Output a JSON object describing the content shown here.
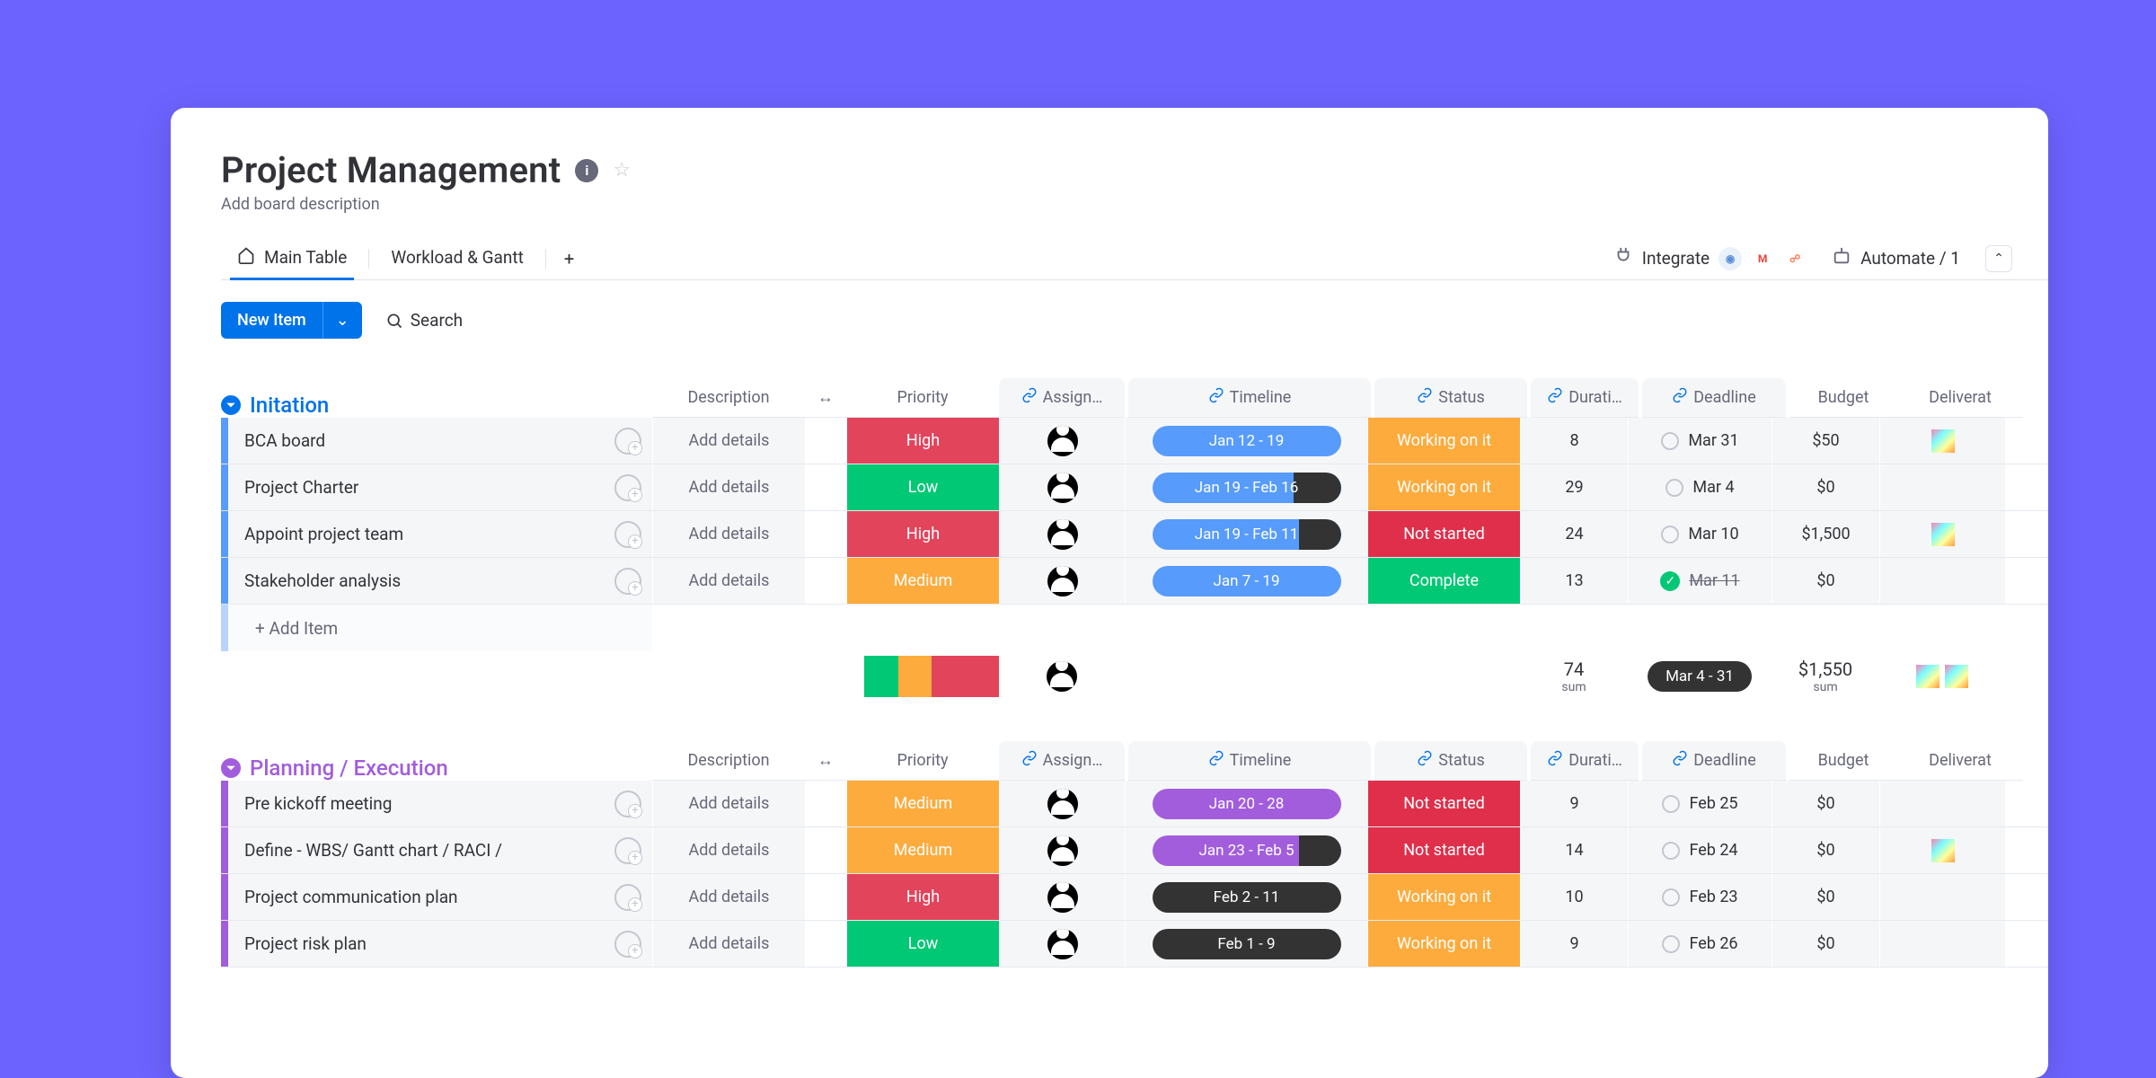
{
  "title": "Project Management",
  "description_placeholder": "Add board description",
  "tabs": {
    "main": "Main Table",
    "workload": "Workload & Gantt"
  },
  "toolbar": {
    "integrate_label": "Integrate",
    "automate_label": "Automate / 1",
    "new_item_label": "New Item",
    "search_label": "Search"
  },
  "columns": {
    "description": "Description",
    "drag": "↔",
    "priority": "Priority",
    "assignee": "Assign…",
    "timeline": "Timeline",
    "status": "Status",
    "duration": "Durati…",
    "deadline": "Deadline",
    "budget": "Budget",
    "deliverable": "Deliverat"
  },
  "priority_colors": {
    "High": "#e2445c",
    "Low": "#00c875",
    "Medium": "#fdab3d"
  },
  "status_colors": {
    "Working on it": "#fdab3d",
    "Not started": "#df2f4a",
    "Complete": "#00c875"
  },
  "group_ui": {
    "add_details": "Add details",
    "add_item": "+ Add Item",
    "sum_label": "sum"
  },
  "groups": [
    {
      "name": "Initation",
      "color": "#579BFC",
      "title_color": "#0073ea",
      "rows": [
        {
          "name": "BCA board",
          "priority": "High",
          "timeline": "Jan 12 - 19",
          "tl_color": "#579BFC",
          "tl_dark_pct": 0,
          "status": "Working on it",
          "duration": "8",
          "deadline": "Mar 31",
          "deadline_done": false,
          "budget": "$50",
          "deliverable": true
        },
        {
          "name": "Project Charter",
          "priority": "Low",
          "timeline": "Jan 19 - Feb 16",
          "tl_color": "#579BFC",
          "tl_dark_pct": 25,
          "status": "Working on it",
          "duration": "29",
          "deadline": "Mar 4",
          "deadline_done": false,
          "budget": "$0",
          "deliverable": false
        },
        {
          "name": "Appoint project team",
          "priority": "High",
          "timeline": "Jan 19 - Feb 11",
          "tl_color": "#579BFC",
          "tl_dark_pct": 22,
          "status": "Not started",
          "duration": "24",
          "deadline": "Mar 10",
          "deadline_done": false,
          "budget": "$1,500",
          "deliverable": true
        },
        {
          "name": "Stakeholder analysis",
          "priority": "Medium",
          "timeline": "Jan 7 - 19",
          "tl_color": "#579BFC",
          "tl_dark_pct": 0,
          "status": "Complete",
          "duration": "13",
          "deadline": "Mar 11",
          "deadline_done": true,
          "budget": "$0",
          "deliverable": false
        }
      ],
      "summary": {
        "priority_mix": [
          "#00c875",
          "#fdab3d",
          "#e2445c",
          "#e2445c"
        ],
        "duration_sum": "74",
        "deadline_range": "Mar 4 - 31",
        "budget_sum": "$1,550",
        "deliverable_count": 2
      }
    },
    {
      "name": "Planning / Execution",
      "color": "#a25ddc",
      "title_color": "#a25ddc",
      "rows": [
        {
          "name": "Pre kickoff meeting",
          "priority": "Medium",
          "timeline": "Jan 20 - 28",
          "tl_color": "#a25ddc",
          "tl_dark_pct": 0,
          "status": "Not started",
          "duration": "9",
          "deadline": "Feb 25",
          "deadline_done": false,
          "budget": "$0",
          "deliverable": false
        },
        {
          "name": "Define - WBS/ Gantt chart / RACI /",
          "priority": "Medium",
          "timeline": "Jan 23 - Feb 5",
          "tl_color": "#a25ddc",
          "tl_dark_pct": 22,
          "status": "Not started",
          "duration": "14",
          "deadline": "Feb 24",
          "deadline_done": false,
          "budget": "$0",
          "deliverable": true
        },
        {
          "name": "Project communication plan",
          "priority": "High",
          "timeline": "Feb 2 - 11",
          "tl_color": "#333333",
          "tl_dark_pct": 100,
          "status": "Working on it",
          "duration": "10",
          "deadline": "Feb 23",
          "deadline_done": false,
          "budget": "$0",
          "deliverable": false
        },
        {
          "name": "Project risk plan",
          "priority": "Low",
          "timeline": "Feb 1 - 9",
          "tl_color": "#333333",
          "tl_dark_pct": 100,
          "status": "Working on it",
          "duration": "9",
          "deadline": "Feb 26",
          "deadline_done": false,
          "budget": "$0",
          "deliverable": false
        }
      ]
    }
  ]
}
